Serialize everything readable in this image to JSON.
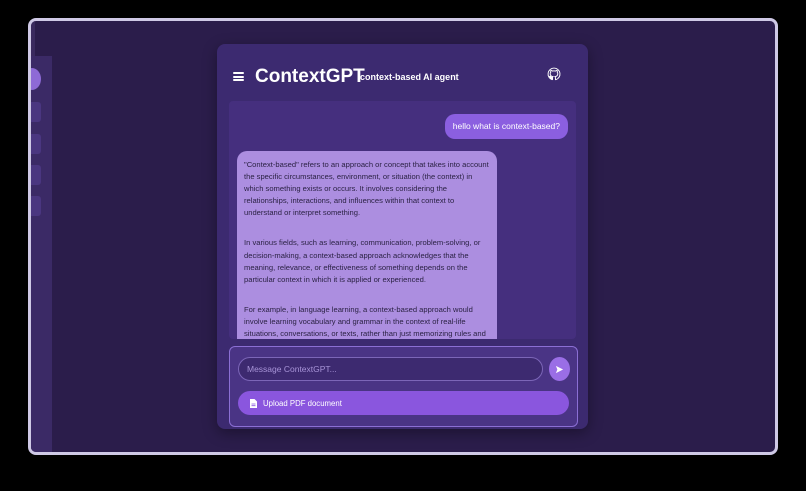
{
  "app": {
    "title": "ContextGPT",
    "subtitle": "context-based AI agent"
  },
  "icons": {
    "menu": "hamburger-icon",
    "github": "github-icon",
    "send": "send-icon",
    "upload": "file-icon"
  },
  "colors": {
    "background": "#2b1d4b",
    "panel": "#3c2a70",
    "accent": "#8b5fe0",
    "assistant_bubble": "#ac8ee0"
  },
  "chat": {
    "messages": [
      {
        "role": "user",
        "text": "hello what is context-based?"
      },
      {
        "role": "assistant",
        "paragraphs": [
          "\"Context-based\" refers to an approach or concept that takes into account the specific circumstances, environment, or situation (the context) in which something exists or occurs. It involves considering the relationships, interactions, and influences within that context to understand or interpret something.",
          "In various fields, such as learning, communication, problem-solving, or decision-making, a context-based approach acknowledges that the meaning, relevance, or effectiveness of something depends on the particular context in which it is applied or experienced.",
          "For example, in language learning, a context-based approach would involve learning vocabulary and grammar in the context of real-life situations, conversations, or texts, rather than just memorizing rules and"
        ]
      }
    ]
  },
  "composer": {
    "placeholder": "Message ContextGPT...",
    "upload_label": "Upload PDF document"
  }
}
